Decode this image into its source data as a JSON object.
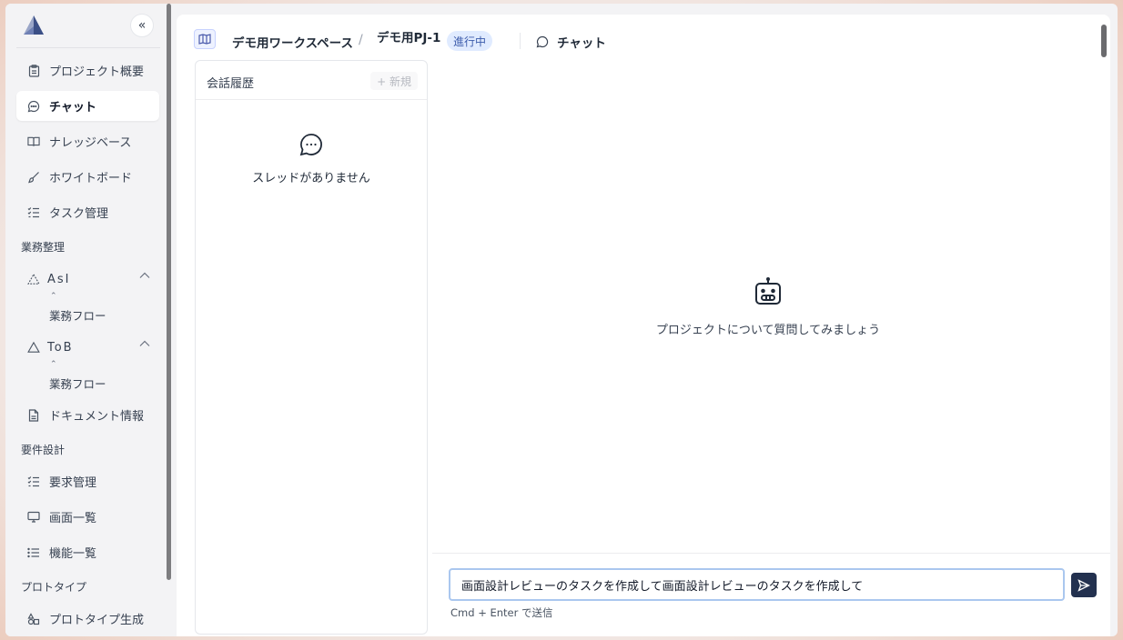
{
  "sidebar": {
    "collapse_label": "«",
    "items_top": [
      {
        "label": "プロジェクト概要",
        "icon": "clipboard-icon"
      },
      {
        "label": "チャット",
        "icon": "chat-bubble-icon",
        "active": true
      },
      {
        "label": "ナレッジベース",
        "icon": "book-icon"
      },
      {
        "label": "ホワイトボード",
        "icon": "brush-icon"
      },
      {
        "label": "タスク管理",
        "icon": "checklist-icon"
      }
    ],
    "section_business": "業務整理",
    "groups": [
      {
        "label": "AsI",
        "caret": "⌃",
        "sub": "業務フロー"
      },
      {
        "label": "ToB",
        "caret": "⌃",
        "sub": "業務フロー"
      }
    ],
    "doc_item": "ドキュメント情報",
    "section_requirements": "要件設計",
    "req_items": [
      "要求管理",
      "画面一覧",
      "機能一覧"
    ],
    "section_prototype": "プロトタイプ",
    "proto_item": "プロトタイプ生成"
  },
  "header": {
    "workspace": "デモ用ワークスペース",
    "separator": "/",
    "project": "デモ用PJ-1",
    "status": "進行中",
    "page_title": "チャット"
  },
  "history": {
    "title": "会話履歴",
    "new_label": "+ 新規",
    "empty_text": "スレッドがありません"
  },
  "chat": {
    "empty_text": "プロジェクトについて質問してみましょう",
    "input_value": "画面設計レビューのタスクを作成して画面設計レビューのタスクを作成して",
    "hint": "Cmd + Enter で送信"
  },
  "colors": {
    "accent": "#23314f",
    "badge_bg": "#e0ebff",
    "badge_text": "#3b5bab",
    "input_focus": "#aac7ef"
  }
}
